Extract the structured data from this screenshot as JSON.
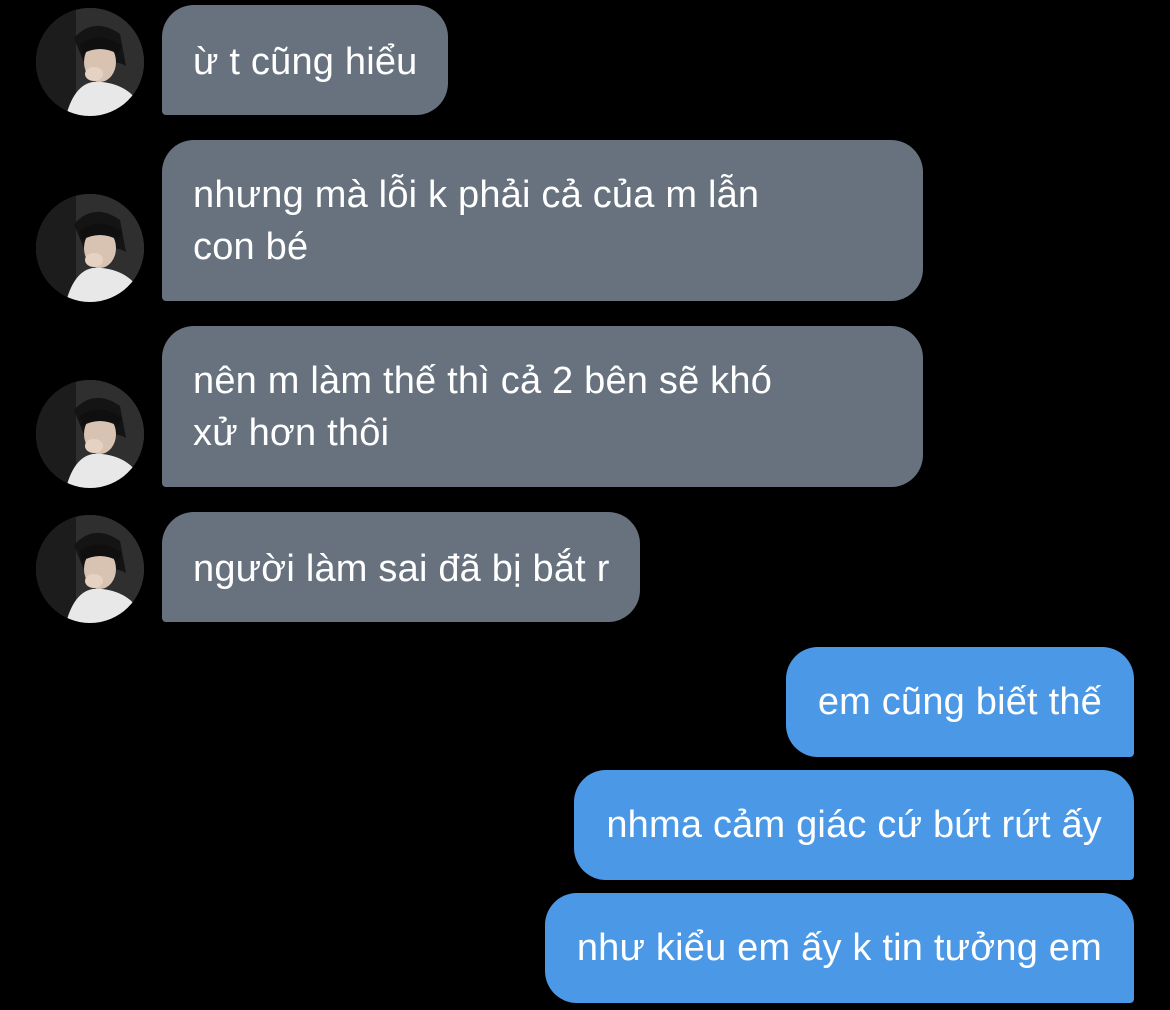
{
  "chat": {
    "received_messages": [
      {
        "text": "ừ t cũng hiểu"
      },
      {
        "text": "nhưng mà lỗi k phải cả của m lẫn\ncon bé"
      },
      {
        "text": "nên m làm thế thì cả 2 bên sẽ khó\nxử hơn thôi"
      },
      {
        "text": "người làm sai đã bị bắt r"
      }
    ],
    "sent_messages": [
      {
        "text": "em cũng biết thế"
      },
      {
        "text": "nhma cảm giác cứ bứt rứt ấy"
      },
      {
        "text": "như kiểu em ấy k tin tưởng em"
      }
    ],
    "colors": {
      "background": "#000000",
      "received_bubble": "#67727e",
      "sent_bubble": "#4a98e6",
      "text": "#ffffff"
    },
    "icons": {
      "avatar": "contact-avatar-photo"
    }
  }
}
